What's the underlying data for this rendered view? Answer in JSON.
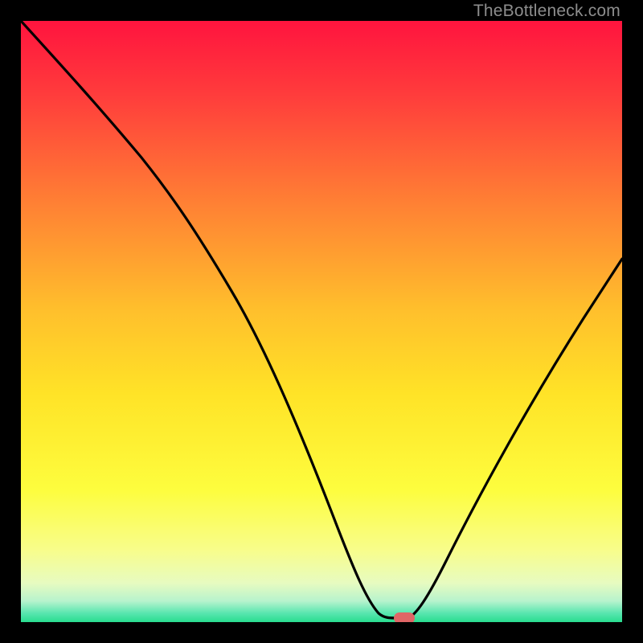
{
  "watermark": "TheBottleneck.com",
  "chart_data": {
    "type": "line",
    "title": "",
    "xlabel": "",
    "ylabel": "",
    "xlim": [
      0,
      100
    ],
    "ylim": [
      0,
      100
    ],
    "grid": false,
    "legend": false,
    "background": {
      "type": "vertical-gradient",
      "stops": [
        {
          "pos": 0.0,
          "color": "#ff143e"
        },
        {
          "pos": 0.12,
          "color": "#ff3b3c"
        },
        {
          "pos": 0.3,
          "color": "#ff7f34"
        },
        {
          "pos": 0.48,
          "color": "#ffbf2c"
        },
        {
          "pos": 0.62,
          "color": "#ffe327"
        },
        {
          "pos": 0.78,
          "color": "#fdfd3e"
        },
        {
          "pos": 0.88,
          "color": "#f8fd8b"
        },
        {
          "pos": 0.935,
          "color": "#e7fbc0"
        },
        {
          "pos": 0.965,
          "color": "#b7f3cd"
        },
        {
          "pos": 0.985,
          "color": "#59e6b0"
        },
        {
          "pos": 1.0,
          "color": "#29dd8f"
        }
      ]
    },
    "series": [
      {
        "name": "bottleneck-curve",
        "color": "#000000",
        "x": [
          0,
          5,
          10,
          15,
          20,
          25,
          30,
          35,
          40,
          45,
          50,
          54,
          58,
          60,
          62,
          64,
          70,
          76,
          82,
          88,
          94,
          100
        ],
        "y": [
          100,
          94,
          87,
          80,
          72,
          65,
          55,
          45,
          35,
          25,
          15,
          7,
          2,
          1,
          1,
          2,
          10,
          20,
          30,
          40,
          50,
          60
        ]
      }
    ],
    "marker": {
      "name": "current-config",
      "x": 62,
      "y": 1,
      "color": "#e06666",
      "shape": "rounded-pill"
    }
  }
}
